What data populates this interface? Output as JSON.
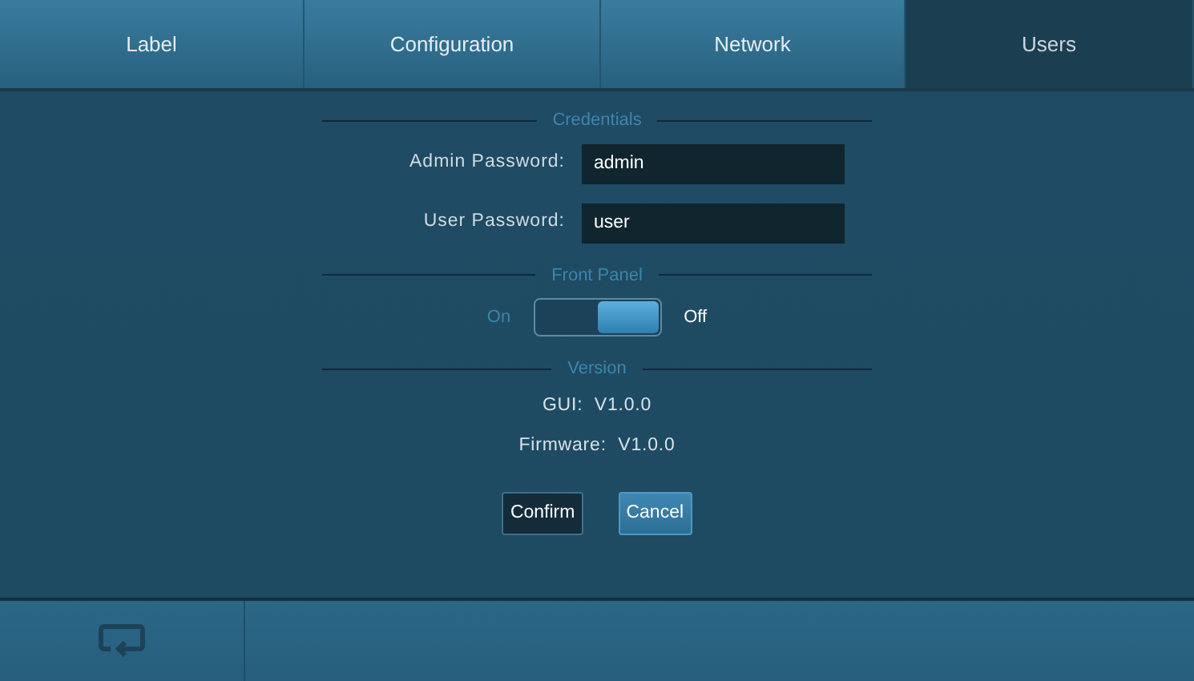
{
  "tabs": [
    {
      "label": "Label",
      "selected": false
    },
    {
      "label": "Configuration",
      "selected": false
    },
    {
      "label": "Network",
      "selected": false
    },
    {
      "label": "Users",
      "selected": true
    }
  ],
  "sections": [
    {
      "kind": "fields",
      "title": "Credentials",
      "fields": [
        {
          "label": "Admin Password:",
          "value": "admin"
        },
        {
          "label": "User Password:",
          "value": "user"
        }
      ]
    },
    {
      "kind": "toggle",
      "title": "Front Panel",
      "on_label": "On",
      "off_label": "Off",
      "on": false
    },
    {
      "kind": "info",
      "title": "Version",
      "lines": [
        "GUI:  V1.0.0",
        "Firmware:  V1.0.0"
      ]
    }
  ],
  "buttons": [
    {
      "label": "Confirm",
      "selected": true
    },
    {
      "label": "Cancel",
      "selected": false
    }
  ]
}
